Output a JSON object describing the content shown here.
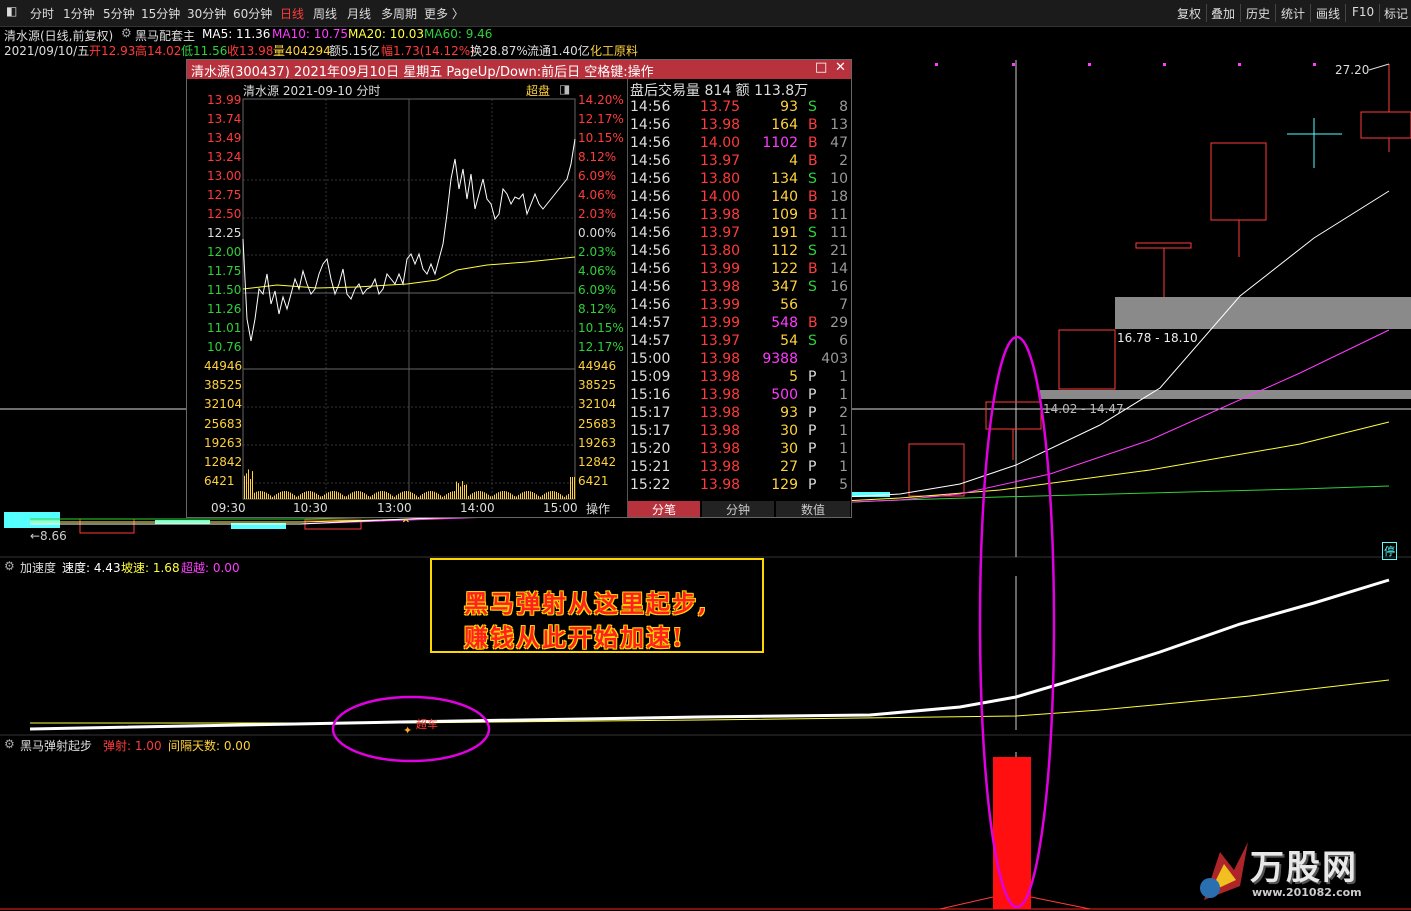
{
  "toolbar": {
    "periods": [
      "分时",
      "1分钟",
      "5分钟",
      "15分钟",
      "30分钟",
      "60分钟",
      "日线",
      "周线",
      "月线",
      "多周期",
      "更多 〉"
    ],
    "active_period": "日线",
    "right": [
      "复权",
      "叠加",
      "历史",
      "统计",
      "画线",
      "F10",
      "标记"
    ]
  },
  "info": {
    "stock_label": "清水源(日线,前复权)",
    "indicator": "黑马配套主",
    "ma5": "MA5: 11.36",
    "ma10": "MA10: 10.75",
    "ma20": "MA20: 10.03",
    "ma60": "MA60: 9.46",
    "date": "2021/09/10/五",
    "open": "开12.93",
    "high": "高14.02",
    "low": "低11.56",
    "close": "收13.98",
    "volume": "量404294",
    "amount": "额5.15亿",
    "amp": "幅1.73(14.12%)",
    "turnover": "换28.87%",
    "float": "流通1.40亿",
    "sector": "化工原料"
  },
  "main_chart": {
    "price_high_label": "27.20",
    "range1": "16.78 - 18.10",
    "range2": "14.02 - 14.47",
    "low_label": "←8.66",
    "badge": "停"
  },
  "popup": {
    "title": "清水源(300437) 2021年09月10日 星期五 PageUp/Down:前后日 空格键:操作",
    "mini_title": "清水源  2021-09-10 分时",
    "super": "超盘",
    "price_labels": [
      "13.99",
      "13.74",
      "13.49",
      "13.24",
      "13.00",
      "12.75",
      "12.50",
      "12.25",
      "12.00",
      "11.75",
      "11.50",
      "11.26",
      "11.01",
      "10.76"
    ],
    "pct_labels": [
      "14.20%",
      "12.17%",
      "10.15%",
      "8.12%",
      "6.09%",
      "4.06%",
      "2.03%",
      "0.00%",
      "2.03%",
      "4.06%",
      "6.09%",
      "8.12%",
      "10.15%",
      "12.17%"
    ],
    "vol_labels": [
      "44946",
      "38525",
      "32104",
      "25683",
      "19263",
      "12842",
      "6421"
    ],
    "time_labels": [
      "09:30",
      "10:30",
      "13:00",
      "14:00",
      "15:00"
    ],
    "op_label": "操作",
    "tick_header": "盘后交易量 814 额 113.8万",
    "ticks": [
      {
        "t": "14:56",
        "p": "13.75",
        "v": "93",
        "d": "S",
        "n": "8"
      },
      {
        "t": "14:56",
        "p": "13.98",
        "v": "164",
        "d": "B",
        "n": "13"
      },
      {
        "t": "14:56",
        "p": "14.00",
        "v": "1102",
        "d": "B",
        "n": "47"
      },
      {
        "t": "14:56",
        "p": "13.97",
        "v": "4",
        "d": "B",
        "n": "2"
      },
      {
        "t": "14:56",
        "p": "13.80",
        "v": "134",
        "d": "S",
        "n": "10"
      },
      {
        "t": "14:56",
        "p": "14.00",
        "v": "140",
        "d": "B",
        "n": "18"
      },
      {
        "t": "14:56",
        "p": "13.98",
        "v": "109",
        "d": "B",
        "n": "11"
      },
      {
        "t": "14:56",
        "p": "13.97",
        "v": "191",
        "d": "S",
        "n": "11"
      },
      {
        "t": "14:56",
        "p": "13.80",
        "v": "112",
        "d": "S",
        "n": "21"
      },
      {
        "t": "14:56",
        "p": "13.99",
        "v": "122",
        "d": "B",
        "n": "14"
      },
      {
        "t": "14:56",
        "p": "13.98",
        "v": "347",
        "d": "S",
        "n": "16"
      },
      {
        "t": "14:56",
        "p": "13.99",
        "v": "56",
        "d": "",
        "n": "7"
      },
      {
        "t": "14:57",
        "p": "13.99",
        "v": "548",
        "d": "B",
        "n": "29"
      },
      {
        "t": "14:57",
        "p": "13.97",
        "v": "54",
        "d": "S",
        "n": "6"
      },
      {
        "t": "15:00",
        "p": "13.98",
        "v": "9388",
        "d": "",
        "n": "403"
      },
      {
        "t": "15:09",
        "p": "13.98",
        "v": "5",
        "d": "P",
        "n": "1"
      },
      {
        "t": "15:16",
        "p": "13.98",
        "v": "500",
        "d": "P",
        "n": "1"
      },
      {
        "t": "15:17",
        "p": "13.98",
        "v": "93",
        "d": "P",
        "n": "2"
      },
      {
        "t": "15:17",
        "p": "13.98",
        "v": "30",
        "d": "P",
        "n": "1"
      },
      {
        "t": "15:20",
        "p": "13.98",
        "v": "30",
        "d": "P",
        "n": "1"
      },
      {
        "t": "15:21",
        "p": "13.98",
        "v": "27",
        "d": "P",
        "n": "1"
      },
      {
        "t": "15:22",
        "p": "13.98",
        "v": "129",
        "d": "P",
        "n": "5"
      }
    ],
    "tabs": [
      "分笔",
      "分钟",
      "数值"
    ]
  },
  "accel": {
    "name": "加速度",
    "speed": "速度: 4.43",
    "slope": "坡速: 1.68",
    "over": "超越: 0.00",
    "marker": "超车"
  },
  "callout": {
    "line1": "黑马弹射从这里起步,",
    "line2": "赚钱从此开始加速!"
  },
  "launch": {
    "name": "黑马弹射起步",
    "launch": "弹射: 1.00",
    "interval": "间隔天数: 0.00"
  },
  "logo": {
    "name": "万股网",
    "url": "www.201082.com"
  },
  "colors": {
    "up": "#ff3b3b",
    "down": "#2fd03a",
    "ma5": "#ffffff",
    "ma10": "#ff3cff",
    "ma20": "#ffff3c",
    "ma60": "#2fd03a",
    "ellipse": "#e000e0"
  }
}
